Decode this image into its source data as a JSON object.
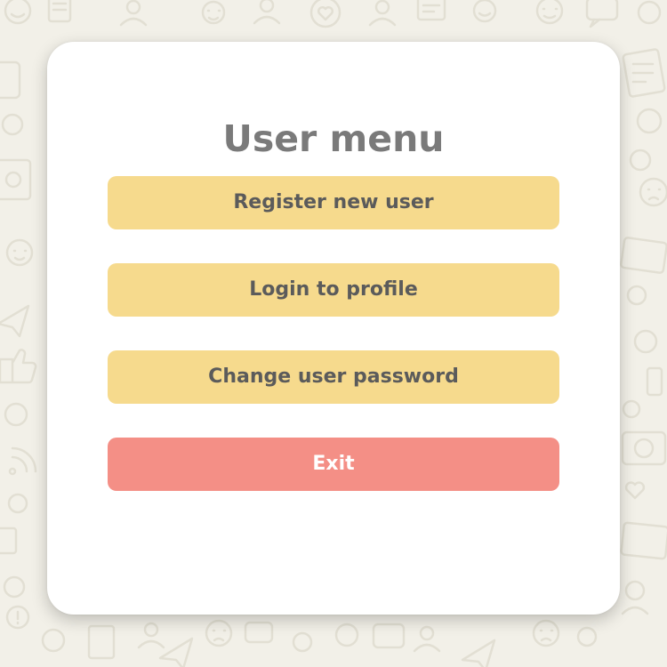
{
  "menu": {
    "title": "User menu",
    "buttons": [
      {
        "label": "Register new user"
      },
      {
        "label": "Login to profile"
      },
      {
        "label": "Change user password"
      },
      {
        "label": "Exit"
      }
    ]
  },
  "colors": {
    "background": "#f2f0e8",
    "pattern": "#e2dfd3",
    "card": "#ffffff",
    "title": "#7a7a7a",
    "button_primary": "#f6da8d",
    "button_primary_text": "#5b5b5b",
    "button_exit": "#f48f86",
    "button_exit_text": "#ffffff"
  },
  "background_pattern_icons": [
    "heart-icon",
    "smiley-icon",
    "thumbs-up-icon",
    "paper-plane-icon",
    "chat-bubble-icon",
    "camera-icon",
    "rss-icon",
    "user-icon",
    "notebook-icon",
    "sad-face-icon"
  ]
}
